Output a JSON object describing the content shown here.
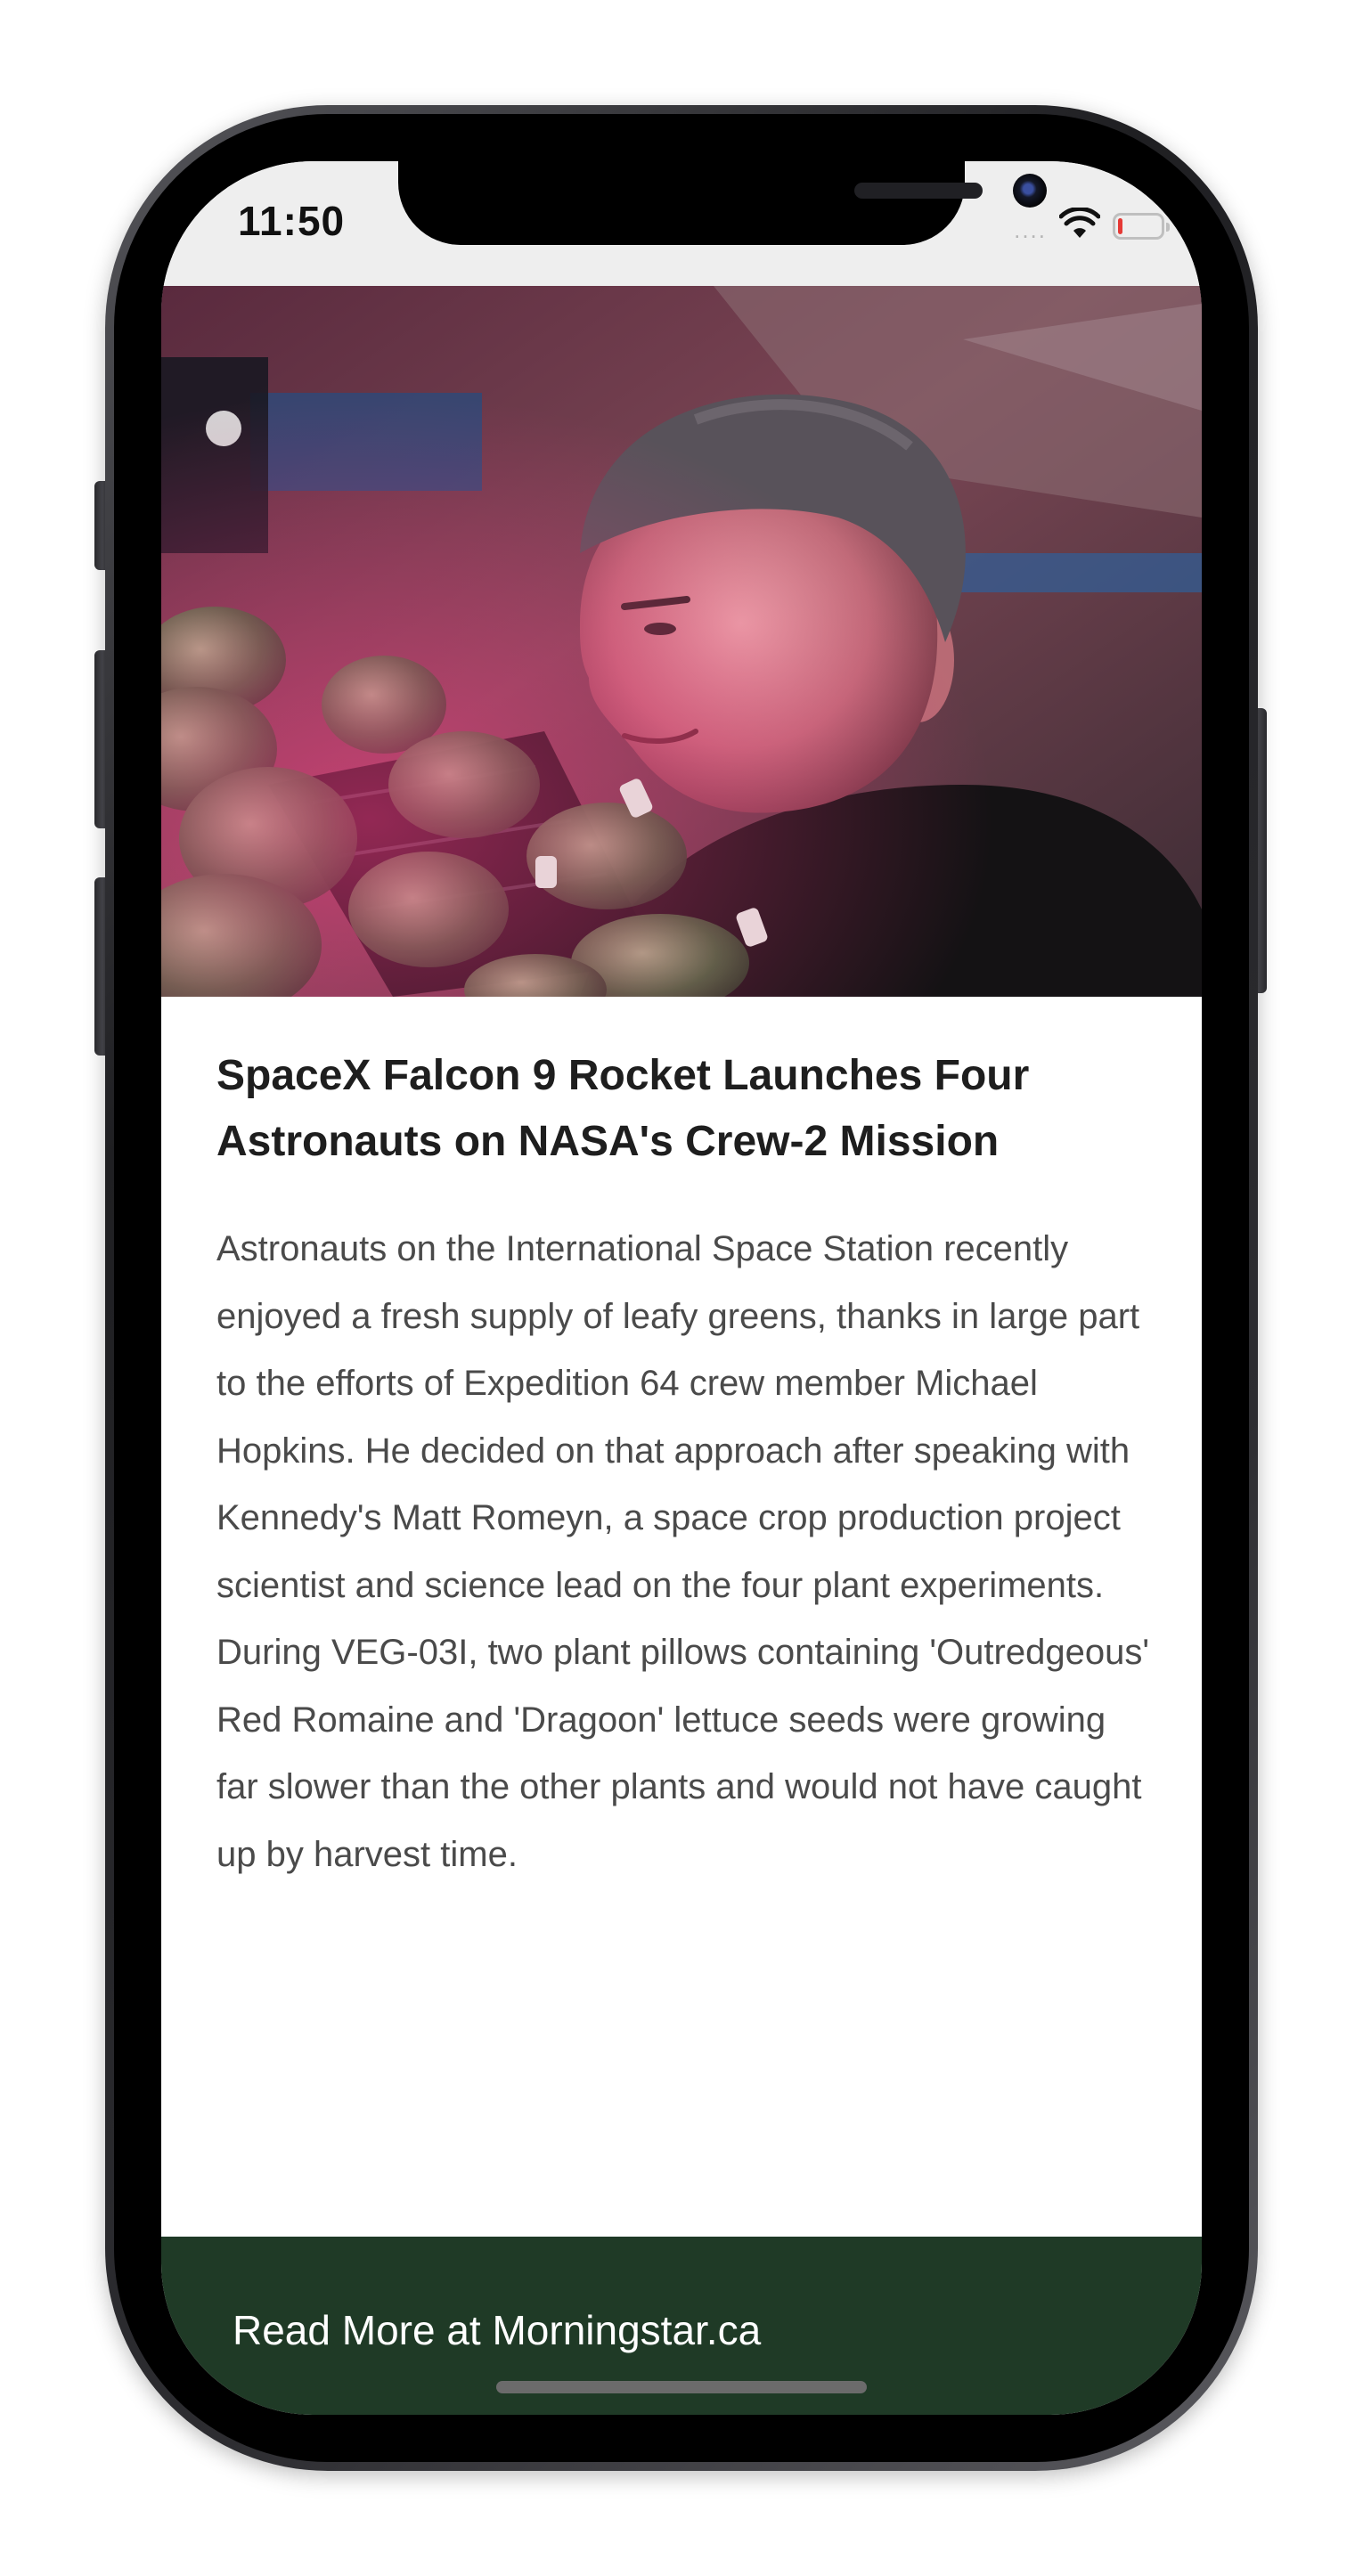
{
  "status_bar": {
    "time": "11:50",
    "signal": "....",
    "battery_level": 0.1,
    "battery_color": "#e53935"
  },
  "article": {
    "image_alt": "Astronaut inspecting leafy green plants under pink grow lights aboard the space station",
    "headline": "SpaceX Falcon 9 Rocket Launches Four Astronauts on NASA's Crew-2 Mission",
    "body": "Astronauts on the International Space Station recently enjoyed a fresh supply of leafy greens, thanks in large part to the efforts of Expedition 64 crew member Michael Hopkins. He decided on that approach after speaking with Kennedy's Matt Romeyn, a space crop production project scientist and science lead on the four plant experiments. During VEG-03I, two plant pillows containing 'Outredgeous' Red Romaine and 'Dragoon' lettuce seeds were growing far slower than the other plants and would not have caught up by harvest time."
  },
  "footer": {
    "link_label": "Read More at Morningstar.ca",
    "background": "#1f3a26"
  },
  "icons": {
    "wifi": "wifi-icon",
    "battery": "battery-icon",
    "signal": "cellular-signal-icon"
  }
}
